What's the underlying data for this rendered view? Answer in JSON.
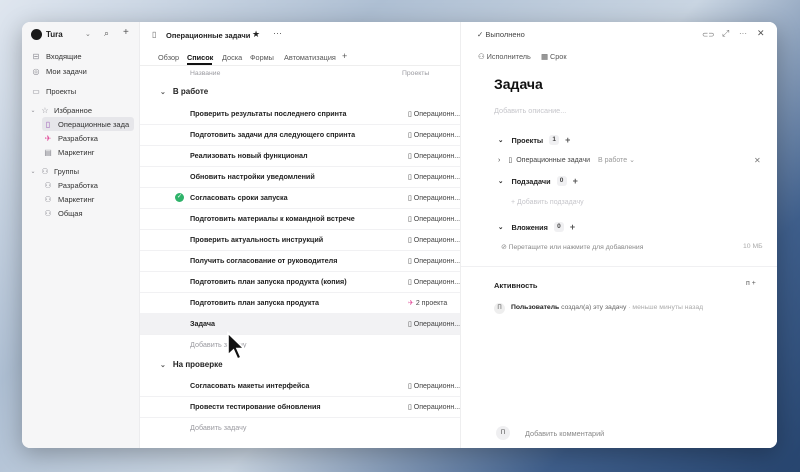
{
  "sidebar": {
    "workspace": "Tura",
    "items": [
      {
        "label": "Входящие",
        "icon": "inbox-icon",
        "glyph": "⊟"
      },
      {
        "label": "Мои задачи",
        "icon": "check-circle-icon",
        "glyph": "◎"
      },
      {
        "label": "Проекты",
        "icon": "folder-icon",
        "glyph": "▭"
      }
    ],
    "favorites_label": "Избранное",
    "favorites": [
      {
        "label": "Операционные зада",
        "glyph": "▯",
        "color": "#9b59b6"
      },
      {
        "label": "Разработка",
        "glyph": "✈",
        "color": "#e24c9a"
      },
      {
        "label": "Маркетинг",
        "glyph": "▤",
        "color": "#888"
      }
    ],
    "groups_label": "Группы",
    "groups": [
      {
        "label": "Разработка"
      },
      {
        "label": "Маркетинг"
      },
      {
        "label": "Общая"
      }
    ]
  },
  "header": {
    "title": "Операционные задачи"
  },
  "tabs": [
    {
      "label": "Обзор"
    },
    {
      "label": "Список"
    },
    {
      "label": "Доска"
    },
    {
      "label": "Формы"
    },
    {
      "label": "Автоматизация"
    }
  ],
  "columns": {
    "name": "Название",
    "project": "Проекты"
  },
  "sections": [
    {
      "title": "В работе",
      "add_label": "Добавить задачу",
      "tasks": [
        {
          "name": "Проверить результаты последнего спринта",
          "project": "Операционн..."
        },
        {
          "name": "Подготовить задачи для следующего спринта",
          "project": "Операционн..."
        },
        {
          "name": "Реализовать новый функционал",
          "project": "Операционн..."
        },
        {
          "name": "Обновить настройки уведомлений",
          "project": "Операционн..."
        },
        {
          "name": "Согласовать сроки запуска",
          "project": "Операционн...",
          "done": true
        },
        {
          "name": "Подготовить материалы к командной встрече",
          "project": "Операционн..."
        },
        {
          "name": "Проверить актуальность инструкций",
          "project": "Операционн..."
        },
        {
          "name": "Получить согласование от руководителя",
          "project": "Операционн..."
        },
        {
          "name": "Подготовить план запуска продукта (копия)",
          "project": "Операционн..."
        },
        {
          "name": "Подготовить план запуска продукта",
          "project": "2 проекта"
        },
        {
          "name": "Задача",
          "project": "Операционн..."
        }
      ]
    },
    {
      "title": "На проверке",
      "add_label": "Добавить задачу",
      "tasks": [
        {
          "name": "Согласовать макеты интерфейса",
          "project": "Операционн..."
        },
        {
          "name": "Провести тестирование обновления",
          "project": "Операционн..."
        }
      ]
    }
  ],
  "detail": {
    "status": "Выполнено",
    "assignee": "Исполнитель",
    "due": "Срок",
    "title": "Задача",
    "description_placeholder": "Добавить описание...",
    "projects_label": "Проекты",
    "projects_count": "1",
    "project_name": "Операционные задачи",
    "project_status": "В работе",
    "subtasks_label": "Подзадачи",
    "subtasks_count": "0",
    "add_subtask": "Добавить подзадачу",
    "attachments_label": "Вложения",
    "attachments_count": "0",
    "drop_text": "Перетащите или нажмите для добавления",
    "size_limit": "10 МБ",
    "activity_label": "Активность",
    "activity_avatar": "П",
    "activity_user": "Пользователь",
    "activity_text": "создал(а) эту задачу",
    "activity_time": "· меньше минуты назад",
    "comment_avatar": "П",
    "comment_placeholder": "Добавить комментарий"
  },
  "colors": {
    "accent": "#2fb36a",
    "window_bg": "#ffffff",
    "sidebar_bg": "#f6f6f7"
  }
}
